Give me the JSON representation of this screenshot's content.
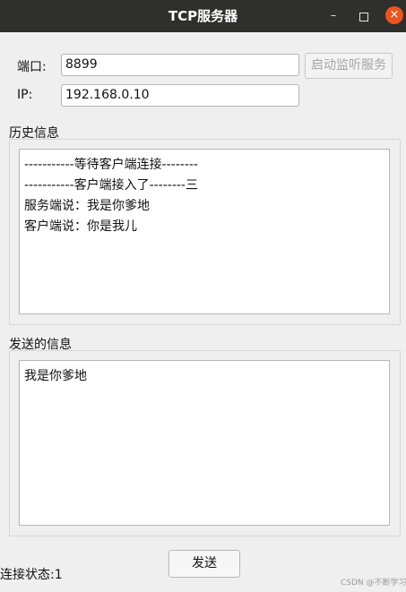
{
  "window": {
    "title": "TCP服务器",
    "minimize_icon": "–",
    "close_icon": "×"
  },
  "form": {
    "port_label": "端口:",
    "port_value": "8899",
    "ip_label": "IP:",
    "ip_value": "192.168.0.10",
    "listen_button": "启动监听服务"
  },
  "history": {
    "title": "历史信息",
    "lines": [
      "-----------等待客户端连接--------",
      "-----------客户端接入了--------三",
      "服务端说：我是你爹地",
      "客户端说：你是我儿"
    ]
  },
  "send": {
    "title": "发送的信息",
    "text": "我是你爹地",
    "button": "发送"
  },
  "status": {
    "text": "连接状态:1"
  },
  "watermark": "CSDN @不断学习。。"
}
